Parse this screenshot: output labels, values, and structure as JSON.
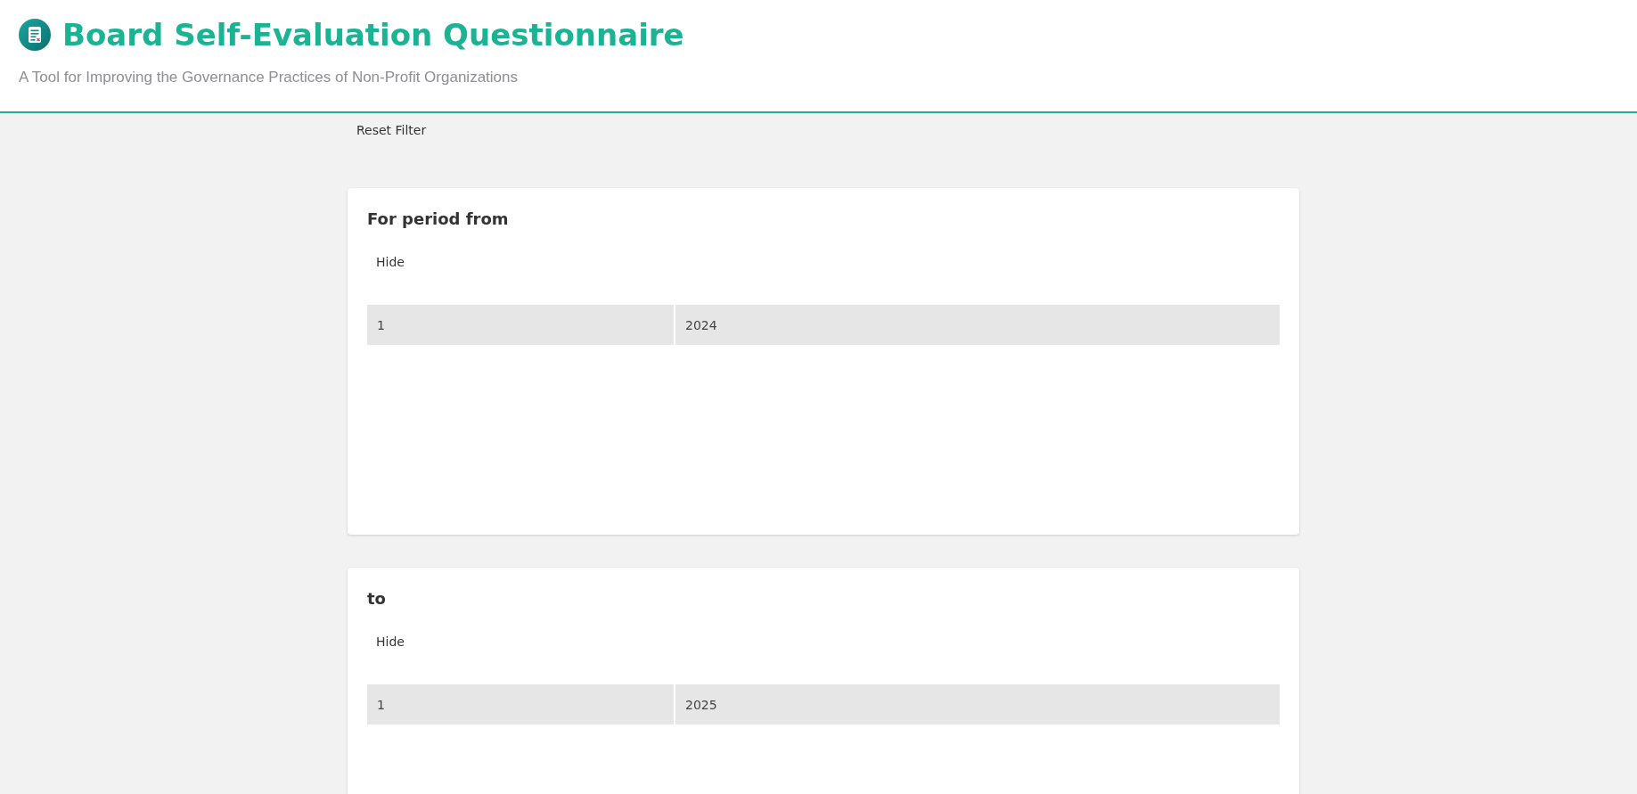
{
  "header": {
    "title": "Board Self-Evaluation Questionnaire",
    "subtitle": "A Tool for Improving the Governance Practices of Non-Profit Organizations"
  },
  "toolbar": {
    "reset_filter": "Reset Filter"
  },
  "cards": [
    {
      "title": "For period from",
      "toggle": "Hide",
      "table": {
        "rows": [
          [
            "1",
            "2024"
          ]
        ]
      }
    },
    {
      "title": "to",
      "toggle": "Hide",
      "table": {
        "rows": [
          [
            "1",
            "2025"
          ]
        ]
      }
    }
  ]
}
